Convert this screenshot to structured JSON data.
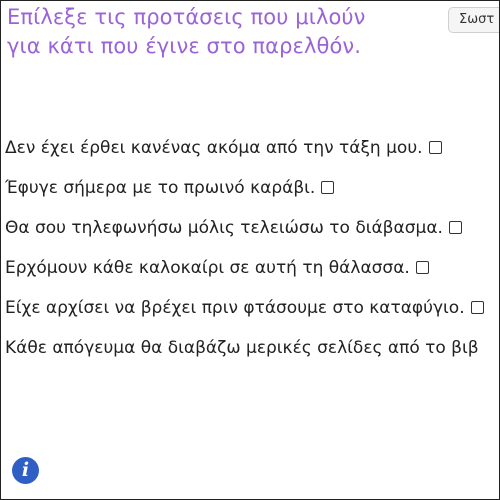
{
  "header": {
    "title_line1": "Επίλεξε τις προτάσεις που μιλούν",
    "title_line2": "για κάτι που έγινε στο παρελθόν.",
    "check_button": "Σωστ"
  },
  "sentences": [
    {
      "text": "Δεν έχει έρθει κανένας ακόμα από την τάξη μου.",
      "checked": false
    },
    {
      "text": "Έφυγε σήμερα με το πρωινό καράβι.",
      "checked": false
    },
    {
      "text": "Θα σου τηλεφωνήσω μόλις τελειώσω το διάβασμα.",
      "checked": false
    },
    {
      "text": "Ερχόμουν κάθε καλοκαίρι σε αυτή τη θάλασσα.",
      "checked": false
    },
    {
      "text": "Είχε αρχίσει να βρέχει πριν φτάσουμε στο καταφύγιο.",
      "checked": false
    },
    {
      "text": "Κάθε απόγευμα θα διαβάζω μερικές σελίδες από το βιβ",
      "checked": false
    }
  ],
  "footer": {
    "info_glyph": "i"
  },
  "colors": {
    "title": "#9a63d8",
    "info": "#2f5fc4"
  }
}
